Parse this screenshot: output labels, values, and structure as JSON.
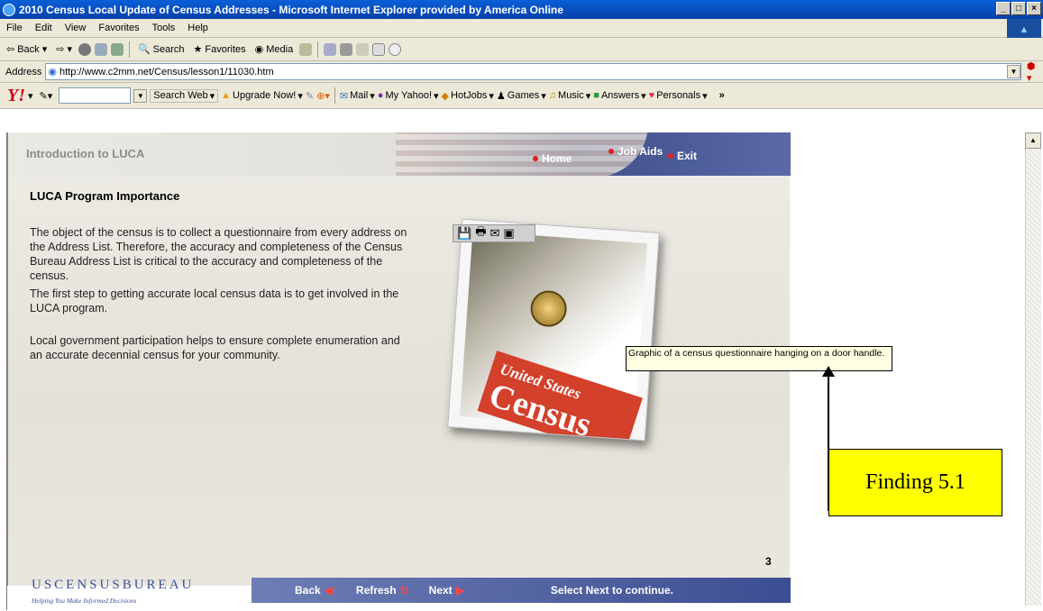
{
  "window": {
    "title": "2010 Census Local Update of Census Addresses - Microsoft Internet Explorer provided by America Online"
  },
  "menu": [
    "File",
    "Edit",
    "View",
    "Favorites",
    "Tools",
    "Help"
  ],
  "toolbar": {
    "back": "Back",
    "search": "Search",
    "favorites": "Favorites",
    "media": "Media"
  },
  "address": {
    "label": "Address",
    "url": "http://www.c2mm.net/Census/lesson1/11030.htm"
  },
  "yahoo": {
    "search_web": "Search Web",
    "upgrade": "Upgrade Now!",
    "items": [
      "Mail",
      "My Yahoo!",
      "HotJobs",
      "Games",
      "Music",
      "Answers",
      "Personals"
    ]
  },
  "page": {
    "course": "Introduction to LUCA",
    "nav": {
      "home": "Home",
      "job_aids": "Job Aids",
      "exit": "Exit"
    },
    "title": "LUCA Program Importance",
    "paragraphs": [
      "The object of the census is to collect a questionnaire from every address on the Address List.  Therefore, the accuracy and completeness of the Census Bureau Address List is critical to the accuracy and completeness of the census.",
      "The first step to getting accurate local census data is to get involved in the LUCA program.",
      "Local government participation helps to ensure complete enumeration and an accurate decennial census for your community."
    ],
    "image_text": {
      "line1": "United States",
      "line2": "Census"
    },
    "tooltip": "Graphic of a census questionnaire hanging on a door handle.",
    "page_number": "3",
    "footer": {
      "logo": "USCENSUSBUREAU",
      "tagline": "Helping You Make Informed Decisions",
      "back": "Back",
      "refresh": "Refresh",
      "next": "Next",
      "instruction": "Select Next to continue."
    }
  },
  "annotation": {
    "label": "Finding 5.1"
  },
  "colors": {
    "titlebar": "#0a5fd8",
    "footer_bar": "#4a5a9e",
    "annotation_fill": "#ffff00",
    "tooltip_bg": "#ffffe1"
  }
}
